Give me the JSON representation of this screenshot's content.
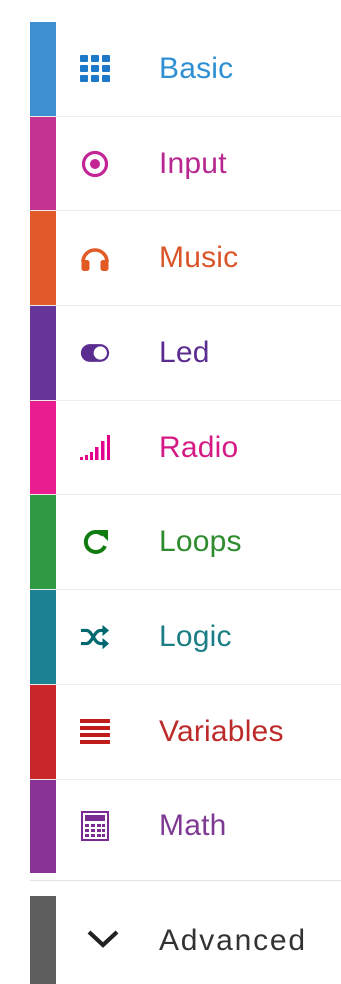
{
  "toolbox": {
    "categories": [
      {
        "label": "Basic",
        "icon": "grid-icon",
        "color": "#1e90ff",
        "text_color": "#2f8fd3",
        "bar_color": "#3d8fd2"
      },
      {
        "label": "Input",
        "icon": "radio-button-icon",
        "color": "#c32595",
        "text_color": "#b8278f",
        "bar_color": "#c3338f"
      },
      {
        "label": "Music",
        "icon": "headphones-icon",
        "color": "#e25b24",
        "text_color": "#d9562a",
        "bar_color": "#e35a2a"
      },
      {
        "label": "Led",
        "icon": "toggle-icon",
        "color": "#5c2d91",
        "text_color": "#5c2d91",
        "bar_color": "#67359a"
      },
      {
        "label": "Radio",
        "icon": "signal-bars-icon",
        "color": "#e3008c",
        "text_color": "#d61a85",
        "bar_color": "#ea1d8f"
      },
      {
        "label": "Loops",
        "icon": "refresh-icon",
        "color": "#107c10",
        "text_color": "#2e8b2e",
        "bar_color": "#2f9a44"
      },
      {
        "label": "Logic",
        "icon": "shuffle-icon",
        "color": "#006970",
        "text_color": "#1b7d85",
        "bar_color": "#1b8293"
      },
      {
        "label": "Variables",
        "icon": "list-icon",
        "color": "#c01c1c",
        "text_color": "#bc2a2a",
        "bar_color": "#c9262b"
      },
      {
        "label": "Math",
        "icon": "calculator-icon",
        "color": "#7b2a91",
        "text_color": "#7e3a93",
        "bar_color": "#8a3396"
      }
    ],
    "advanced": {
      "label": "Advanced",
      "icon": "chevron-down-icon",
      "bar_color": "#5e5e5e"
    }
  }
}
